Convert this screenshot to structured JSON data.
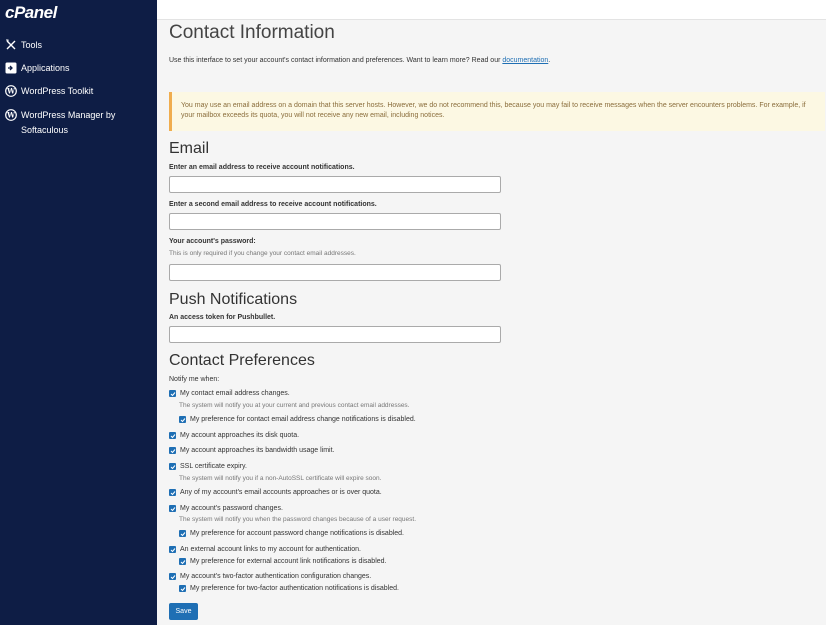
{
  "brand": {
    "logo": "cPanel"
  },
  "sidebar": {
    "items": [
      {
        "label": "Tools",
        "icon": "tools-icon"
      },
      {
        "label": "Applications",
        "icon": "applications-icon"
      },
      {
        "label": "WordPress Toolkit",
        "icon": "wordpress-icon"
      },
      {
        "label": "WordPress Manager by Softaculous",
        "icon": "wordpress-icon"
      }
    ]
  },
  "page": {
    "title": "Contact Information",
    "intro": "Use this interface to set your account's contact information and preferences. Want to learn more? Read our ",
    "intro_link": "documentation",
    "intro_end": "."
  },
  "alert": {
    "text": "You may use an email address on a domain that this server hosts. However, we do not recommend this, because you may fail to receive messages when the server encounters problems. For example, if your mailbox exceeds its quota, you will not receive any new email, including notices."
  },
  "email": {
    "heading": "Email",
    "primary_label": "Enter an email address to receive account notifications.",
    "primary_value": "",
    "secondary_label": "Enter a second email address to receive account notifications.",
    "secondary_value": "",
    "password_label": "Your account's password:",
    "password_help": "This is only required if you change your contact email addresses.",
    "password_value": ""
  },
  "push": {
    "heading": "Push Notifications",
    "token_label": "An access token for Pushbullet.",
    "token_value": ""
  },
  "prefs": {
    "heading": "Contact Preferences",
    "notify_label": "Notify me when:",
    "items": [
      {
        "label": "My contact email address changes.",
        "checked": true
      },
      {
        "help": "The system will notify you at your current and previous contact email addresses."
      },
      {
        "label": "My preference for contact email address change notifications is disabled.",
        "checked": true
      },
      {
        "label": "My account approaches its disk quota.",
        "checked": true
      },
      {
        "label": "My account approaches its bandwidth usage limit.",
        "checked": true
      },
      {
        "label": "SSL certificate expiry.",
        "checked": true
      },
      {
        "help": "The system will notify you if a non-AutoSSL certificate will expire soon."
      },
      {
        "label": "Any of my account's email accounts approaches or is over quota.",
        "checked": true
      },
      {
        "label": "My account's password changes.",
        "checked": true
      },
      {
        "help": "The system will notify you when the password changes because of a user request."
      },
      {
        "label": "My preference for account password change notifications is disabled.",
        "checked": true
      },
      {
        "label": "An external account links to my account for authentication.",
        "checked": true
      },
      {
        "label": "My preference for external account link notifications is disabled.",
        "checked": true
      },
      {
        "label": "My account's two-factor authentication configuration changes.",
        "checked": true
      },
      {
        "label": "My preference for two-factor authentication notifications is disabled.",
        "checked": true
      }
    ]
  },
  "actions": {
    "save_label": "Save"
  },
  "colors": {
    "sidebar_bg": "#0e1d45",
    "accent": "#1f6fb4",
    "alert_bg": "#fcf8e3"
  }
}
